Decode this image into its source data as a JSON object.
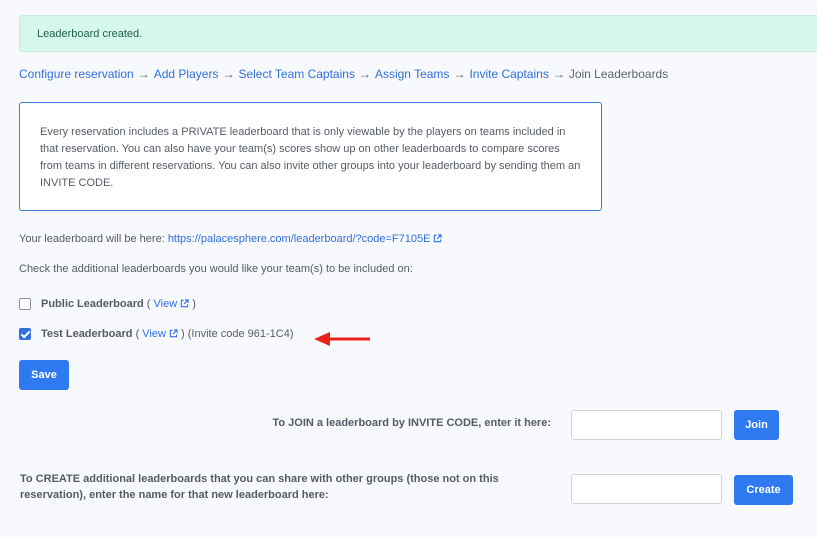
{
  "alert": {
    "message": "Leaderboard created."
  },
  "breadcrumb": {
    "separator": "→",
    "steps": [
      "Configure reservation",
      "Add Players",
      "Select Team Captains",
      "Assign Teams",
      "Invite Captains"
    ],
    "current": "Join Leaderboards"
  },
  "info": {
    "text": "Every reservation includes a PRIVATE leaderboard that is only viewable by the players on teams included in that reservation. You can also have your team(s) scores show up on other leaderboards to compare scores from teams in different reservations. You can also invite other groups into your leaderboard by sending them an INVITE CODE."
  },
  "leaderboard_url": {
    "prefix": "Your leaderboard will be here:",
    "url": "https://palacesphere.com/leaderboard/?code=F7105E",
    "icon": "external-link-icon"
  },
  "check_prompt": "Check the additional leaderboards you would like your team(s) to be included on:",
  "leaderboards": [
    {
      "name": "Public Leaderboard",
      "open_paren": "(",
      "view_label": "View",
      "close_paren": ")",
      "invite_text": "",
      "checked": false
    },
    {
      "name": "Test Leaderboard",
      "open_paren": "(",
      "view_label": "View",
      "close_paren": ")",
      "invite_text": "(Invite code 961-1C4)",
      "checked": true
    }
  ],
  "annotation": {
    "icon": "red-arrow-icon",
    "color": "#e8221b"
  },
  "save_button": {
    "label": "Save"
  },
  "join": {
    "label": "To JOIN a leaderboard by INVITE CODE, enter it here:",
    "value": "",
    "button": "Join"
  },
  "create": {
    "label": "To CREATE additional leaderboards that you can share with other groups (those not on this reservation), enter the name for that new leaderboard here:",
    "value": "",
    "button": "Create"
  },
  "colors": {
    "accent": "#2f7af0",
    "link": "#2f6fe0",
    "alert_bg": "#d6f7ec",
    "background": "#f8f9fc"
  }
}
